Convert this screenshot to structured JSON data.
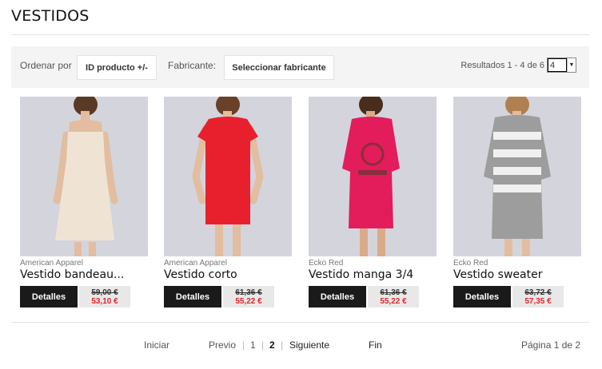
{
  "page": {
    "title": "VESTIDOS"
  },
  "toolbar": {
    "sort_label": "Ordenar por",
    "sort_value": "ID producto +/-",
    "maker_label": "Fabricante:",
    "maker_value": "Seleccionar fabricante",
    "results_text": "Resultados 1 - 4 de 6",
    "per_page_value": "4"
  },
  "products": [
    {
      "brand": "American Apparel",
      "name": "Vestido bandeau...",
      "details_label": "Detalles",
      "old_price": "59,00 €",
      "price": "53,10 €",
      "dress_color": "#efe4d4"
    },
    {
      "brand": "American Apparel",
      "name": "Vestido corto",
      "details_label": "Detalles",
      "old_price": "61,36 €",
      "price": "55,22 €",
      "dress_color": "#e8202e"
    },
    {
      "brand": "Ecko Red",
      "name": "Vestido manga 3/4",
      "details_label": "Detalles",
      "old_price": "61,36 €",
      "price": "55,22 €",
      "dress_color": "#e31c5c"
    },
    {
      "brand": "Ecko Red",
      "name": "Vestido sweater",
      "details_label": "Detalles",
      "old_price": "63,72 €",
      "price": "57,35 €",
      "dress_color": "#9d9d9d"
    }
  ],
  "pagination": {
    "first": "Iniciar",
    "prev": "Previo",
    "pages": [
      "1",
      "2"
    ],
    "current_page": "2",
    "next": "Siguiente",
    "last": "Fin",
    "page_info": "Página 1 de 2"
  },
  "colors": {
    "price_red": "#e0262a",
    "button_dark": "#1a1a1a",
    "toolbar_bg": "#f4f4f4"
  }
}
